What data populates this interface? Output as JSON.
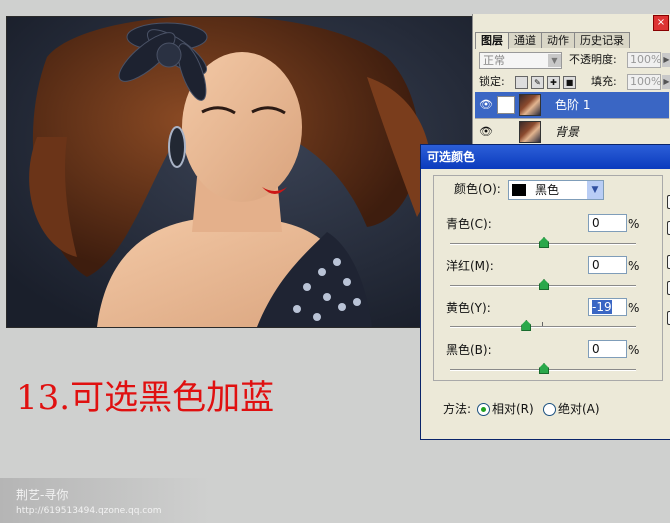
{
  "layers_panel": {
    "tabs": [
      "图层",
      "通道",
      "动作",
      "历史记录"
    ],
    "blend_mode": "正常",
    "opacity_label": "不透明度:",
    "opacity_value": "100%",
    "lock_label": "锁定:",
    "fill_label": "填充:",
    "fill_value": "100%",
    "close_glyph": "×",
    "layers": [
      {
        "name": "色阶 1",
        "selected": true
      },
      {
        "name": "背景",
        "selected": false
      }
    ]
  },
  "dialog": {
    "title": "可选颜色",
    "colors_label": "颜色(O):",
    "colors_value": "黑色",
    "sliders": [
      {
        "label": "青色(C):",
        "value": "0",
        "unit": "%",
        "level": 0
      },
      {
        "label": "洋红(M):",
        "value": "0",
        "unit": "%",
        "level": 0
      },
      {
        "label": "黄色(Y):",
        "value": "-19",
        "unit": "%",
        "level": -19
      },
      {
        "label": "黑色(B):",
        "value": "0",
        "unit": "%",
        "level": 0
      }
    ],
    "method_label": "方法:",
    "method_relative": "相对(R)",
    "method_absolute": "绝对(A)",
    "method_selected": "relative"
  },
  "caption": "13.可选黑色加蓝",
  "watermark": {
    "name": "荆艺-寻你",
    "url": "http://619513494.qzone.qq.com"
  },
  "colors": {
    "caption": "#e01010",
    "titlebar": "#1f4fce",
    "selection": "#3a66c4"
  }
}
